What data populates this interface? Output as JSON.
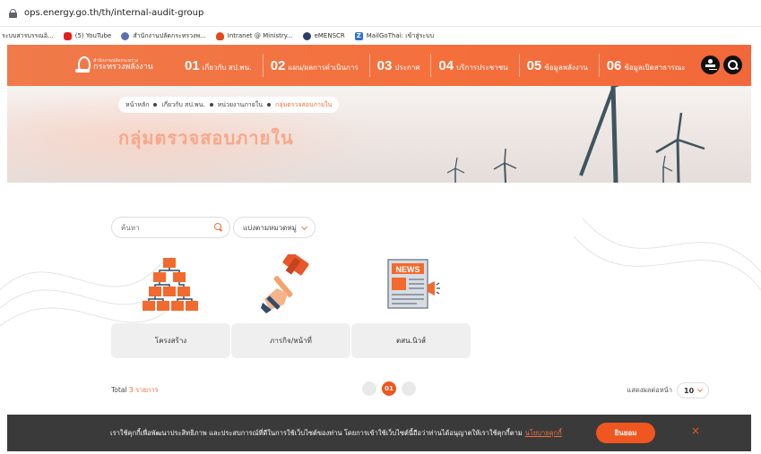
{
  "browser": {
    "url": "ops.energy.go.th/th/internal-audit-group",
    "bookmarks": [
      {
        "label": "ระบบสารบรรณอิ...",
        "icon": "none"
      },
      {
        "label": "(5) YouTube",
        "icon": "youtube-icon"
      },
      {
        "label": "สำนักงานปลัดกระทรวงพ...",
        "icon": "globe-icon"
      },
      {
        "label": "Intranet @ Ministry...",
        "icon": "flame-icon"
      },
      {
        "label": "eMENSCR",
        "icon": "emenscr-icon"
      },
      {
        "label": "MailGoThai: เข้าสู่ระบบ",
        "icon": "zimbra-icon"
      }
    ]
  },
  "nav": {
    "logo_small": "สำนักงานปลัดกระทรวง",
    "logo_big": "กระทรวงพลังงาน",
    "items": [
      {
        "num": "01",
        "label": "เกี่ยวกับ สป.พน."
      },
      {
        "num": "02",
        "label": "แผน/ผลการดำเนินการ"
      },
      {
        "num": "03",
        "label": "ประกาศ"
      },
      {
        "num": "04",
        "label": "บริการประชาชน"
      },
      {
        "num": "05",
        "label": "ข้อมูลพลังงาน"
      },
      {
        "num": "06",
        "label": "ข้อมูลเปิดสาธารณะ"
      }
    ]
  },
  "banner": {
    "breadcrumb": [
      "หน้าหลัก",
      "เกี่ยวกับ สป.พน.",
      "หน่วยงานภายใน",
      "กลุ่มตรวจสอบภายใน"
    ],
    "title": "กลุ่มตรวจสอบภายใน"
  },
  "filters": {
    "search_placeholder": "ค้นหา",
    "category_label": "แบ่งตามหมวดหมู่"
  },
  "cards": [
    {
      "label": "โครงสร้าง",
      "icon": "org-chart-icon"
    },
    {
      "label": "ภารกิจ/หน้าที่",
      "icon": "gavel-hand-icon"
    },
    {
      "label": "ตสน.นิวส์",
      "icon": "news-icon"
    }
  ],
  "listing": {
    "total_prefix": "Total",
    "total_count": "3 รายการ",
    "current_page": "01",
    "per_page_label": "แสดงผลต่อหน้า",
    "per_page_value": "10"
  },
  "cookie": {
    "message": "เราใช้คุกกี้เพื่อพัฒนาประสิทธิภาพ และประสบการณ์ที่ดีในการใช้เว็บไซต์ของท่าน โดยการเข้าใช้เว็บไซต์นี้ถือว่าท่านได้อนุญาตให้เราใช้คุกกี้ตาม",
    "policy_link": "นโยบายคุกกี้",
    "accept_label": "ยินยอม",
    "close_glyph": "×"
  },
  "colors": {
    "accent": "#f0703c",
    "nav_bg": "#f46f3c",
    "cookie_bg": "#3a3a3a"
  }
}
